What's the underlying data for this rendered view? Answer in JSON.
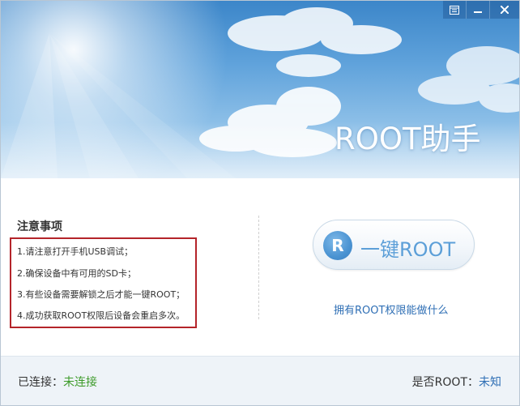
{
  "window": {
    "banner_title": "ROOT助手",
    "controls": {
      "skin_icon": "skin-icon",
      "minimize_icon": "minimize-icon",
      "close_icon": "close-icon"
    }
  },
  "notes": {
    "title": "注意事项",
    "items": [
      "1.请注意打开手机USB调试；",
      "2.确保设备中有可用的SD卡；",
      "3.有些设备需要解锁之后才能一键ROOT；",
      "4.成功获取ROOT权限后设备会重启多次。"
    ],
    "highlight_color": "#b4242a"
  },
  "root_action": {
    "button_label": "一键ROOT",
    "logo_letter": "R",
    "link_text": "拥有ROOT权限能做什么"
  },
  "status": {
    "connection_label": "已连接：",
    "connection_value": "未连接",
    "root_label": "是否ROOT：",
    "root_value": "未知"
  },
  "colors": {
    "accent_blue": "#2f6fb5",
    "status_green": "#3d9b2a"
  }
}
